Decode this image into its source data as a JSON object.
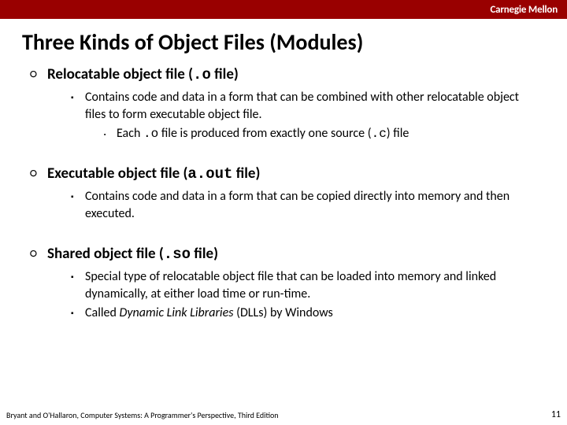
{
  "header": {
    "brand": "Carnegie Mellon"
  },
  "title": "Three Kinds of Object Files (Modules)",
  "items": [
    {
      "head_pre": "Relocatable object file (",
      "head_code": ".o",
      "head_post": " file)",
      "subs": [
        {
          "text": "Contains code and data in a form that can be combined with other relocatable object files to form executable object file.",
          "subsubs": [
            {
              "pre": "Each ",
              "code1": ".o",
              "mid": " file is produced from exactly one source (",
              "code2": ".c",
              "post": ") file"
            }
          ]
        }
      ]
    },
    {
      "head_pre": "Executable object file (",
      "head_code": "a.out",
      "head_post": " file)",
      "subs": [
        {
          "text": "Contains code and data in a form that can be copied directly into memory and then executed."
        }
      ]
    },
    {
      "head_pre": "Shared object file (",
      "head_code": ".so",
      "head_post": "  file)",
      "subs": [
        {
          "text": "Special type of relocatable object file that can be loaded into memory and linked dynamically, at either load time or run-time."
        },
        {
          "pre": "Called ",
          "italic": "Dynamic Link Libraries",
          "post": " (DLLs) by Windows"
        }
      ]
    }
  ],
  "footer": {
    "attribution": "Bryant and O'Hallaron, Computer Systems: A Programmer's Perspective, Third Edition",
    "page": "11"
  }
}
